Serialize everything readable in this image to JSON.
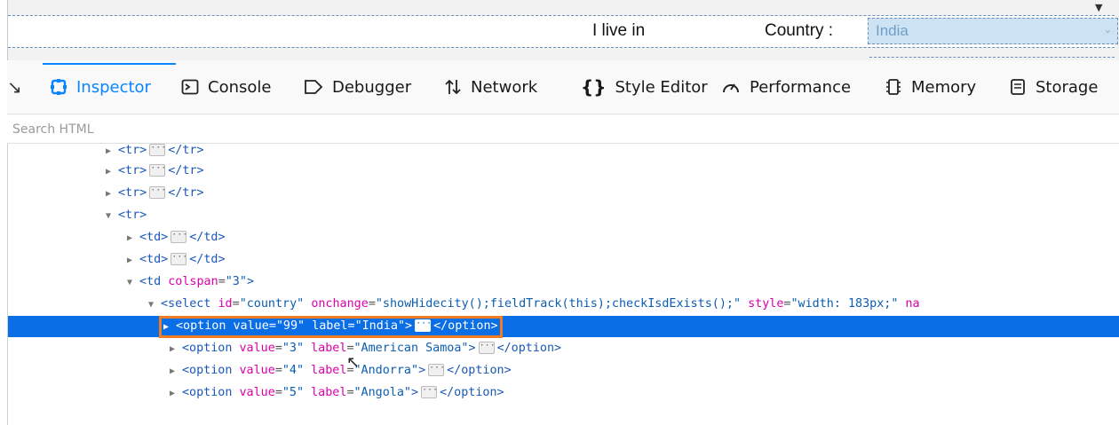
{
  "page": {
    "live_label": "I live in",
    "country_label": "Country :",
    "country_value": "India"
  },
  "toolbar": {
    "tabs": [
      {
        "label": "Inspector",
        "icon": "inspector-icon",
        "selected": true
      },
      {
        "label": "Console",
        "icon": "console-icon"
      },
      {
        "label": "Debugger",
        "icon": "debugger-icon"
      },
      {
        "label": "Network",
        "icon": "network-icon"
      },
      {
        "label": "Style Editor",
        "icon": "style-editor-icon"
      },
      {
        "label": "Performance",
        "icon": "performance-icon"
      },
      {
        "label": "Memory",
        "icon": "memory-icon"
      },
      {
        "label": "Storage",
        "icon": "storage-icon"
      }
    ]
  },
  "search": {
    "placeholder": "Search HTML"
  },
  "tree": {
    "lines": [
      {
        "tag_open": "<tr>",
        "tag_close": "</tr>"
      },
      {
        "tag_open": "<tr>",
        "tag_close": "</tr>"
      },
      {
        "tag_open": "<tr>",
        "tag_close": "</tr>"
      },
      {
        "tag_open": "<tr>"
      },
      {
        "tag_open": "<td>",
        "tag_close": "</td>"
      },
      {
        "tag_open": "<td>",
        "tag_close": "</td>"
      },
      {
        "tag": "<td",
        "attr": "colspan",
        "value": "\"3\"",
        "end": ">"
      },
      {
        "tag": "<select",
        "attrs": [
          {
            "name": "id",
            "value": "\"country\""
          },
          {
            "name": "onchange",
            "value": "\"showHidecity();fieldTrack(this);checkIsdExists();\""
          },
          {
            "name": "style",
            "value": "\"width: 183px;\""
          },
          {
            "name": "na",
            "value": ""
          }
        ]
      },
      {
        "tag": "<option",
        "attrs": [
          {
            "name": "value",
            "value": "\"99\""
          },
          {
            "name": "label",
            "value": "\"India\""
          }
        ],
        "end": ">",
        "close": "</option>",
        "selected": true
      },
      {
        "tag": "<option",
        "attrs": [
          {
            "name": "value",
            "value": "\"3\""
          },
          {
            "name": "label",
            "value": "\"American Samoa\""
          }
        ],
        "end": ">",
        "close": "</option>"
      },
      {
        "tag": "<option",
        "attrs": [
          {
            "name": "value",
            "value": "\"4\""
          },
          {
            "name": "label",
            "value": "\"Andorra\""
          }
        ],
        "end": ">",
        "close": "</option>"
      },
      {
        "tag": "<option",
        "attrs": [
          {
            "name": "value",
            "value": "\"5\""
          },
          {
            "name": "label",
            "value": "\"Angola\""
          }
        ],
        "end": ">",
        "close": "</option>"
      }
    ]
  },
  "colors": {
    "accent": "#0a84ff",
    "selection": "#0a6ee6",
    "highlight_box": "#f07d22",
    "tag": "#1b58b7",
    "attr_name": "#dd00a9",
    "attr_value": "#0c5db0"
  }
}
